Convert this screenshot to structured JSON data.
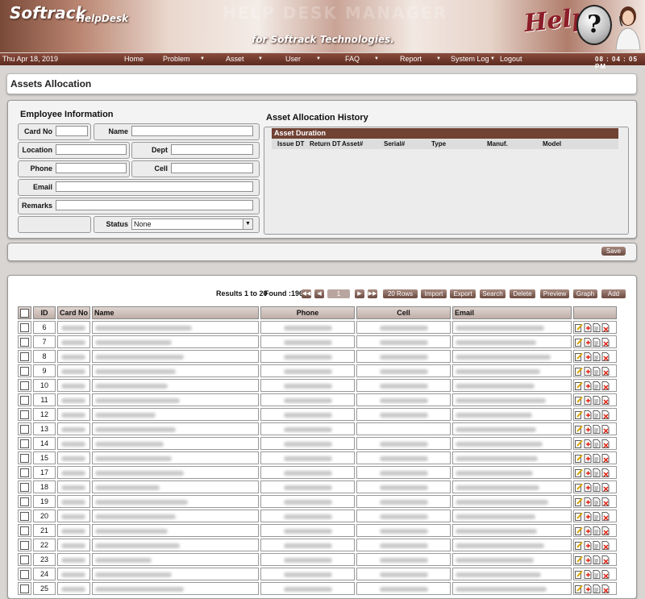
{
  "header": {
    "brand": "Softrack",
    "product": "HelpDesk",
    "watermark": "HELP DESK MANAGER",
    "tagline": "for Softrack Technologies.",
    "help_logo": "Help"
  },
  "nav": {
    "date": "Thu Apr 18, 2019",
    "items": [
      {
        "label": "Home"
      },
      {
        "label": "Problem"
      },
      {
        "label": "Asset"
      },
      {
        "label": "User"
      },
      {
        "label": "FAQ"
      },
      {
        "label": "Report"
      },
      {
        "label": "System Log"
      },
      {
        "label": "Logout"
      }
    ],
    "time": "08 : 04 : 05 PM"
  },
  "page": {
    "title": "Assets Allocation"
  },
  "employee": {
    "title": "Employee Information",
    "card_no_label": "Card No",
    "name_label": "Name",
    "location_label": "Location",
    "dept_label": "Dept",
    "phone_label": "Phone",
    "cell_label": "Cell",
    "email_label": "Email",
    "remarks_label": "Remarks",
    "status_label": "Status",
    "status_value": "None"
  },
  "history": {
    "title": "Asset Allocation History",
    "header": "Asset Duration",
    "columns": [
      "Issue DT",
      "Return DT",
      "Asset#",
      "Serial#",
      "Type",
      "Manuf.",
      "Model"
    ]
  },
  "save_label": "Save",
  "grid": {
    "results": "Results 1 to 20",
    "found": "Found :196",
    "page": "1",
    "buttons": [
      "20 Rows",
      "Import",
      "Export",
      "Search",
      "Delete",
      "Preview",
      "Graph",
      "Add"
    ],
    "columns": [
      "ID",
      "Card No",
      "Name",
      "Phone",
      "Cell",
      "Email"
    ],
    "rows": [
      {
        "id": "6"
      },
      {
        "id": "7"
      },
      {
        "id": "8"
      },
      {
        "id": "9"
      },
      {
        "id": "10"
      },
      {
        "id": "11"
      },
      {
        "id": "12"
      },
      {
        "id": "13"
      },
      {
        "id": "14"
      },
      {
        "id": "15"
      },
      {
        "id": "17"
      },
      {
        "id": "18"
      },
      {
        "id": "19"
      },
      {
        "id": "20"
      },
      {
        "id": "21"
      },
      {
        "id": "22"
      },
      {
        "id": "23"
      },
      {
        "id": "24"
      },
      {
        "id": "25"
      }
    ]
  },
  "colors": {
    "nav_bg": "#6e3426",
    "accent": "#704234",
    "button": "#8a6a60",
    "panel_bg": "#f3f3f3"
  }
}
